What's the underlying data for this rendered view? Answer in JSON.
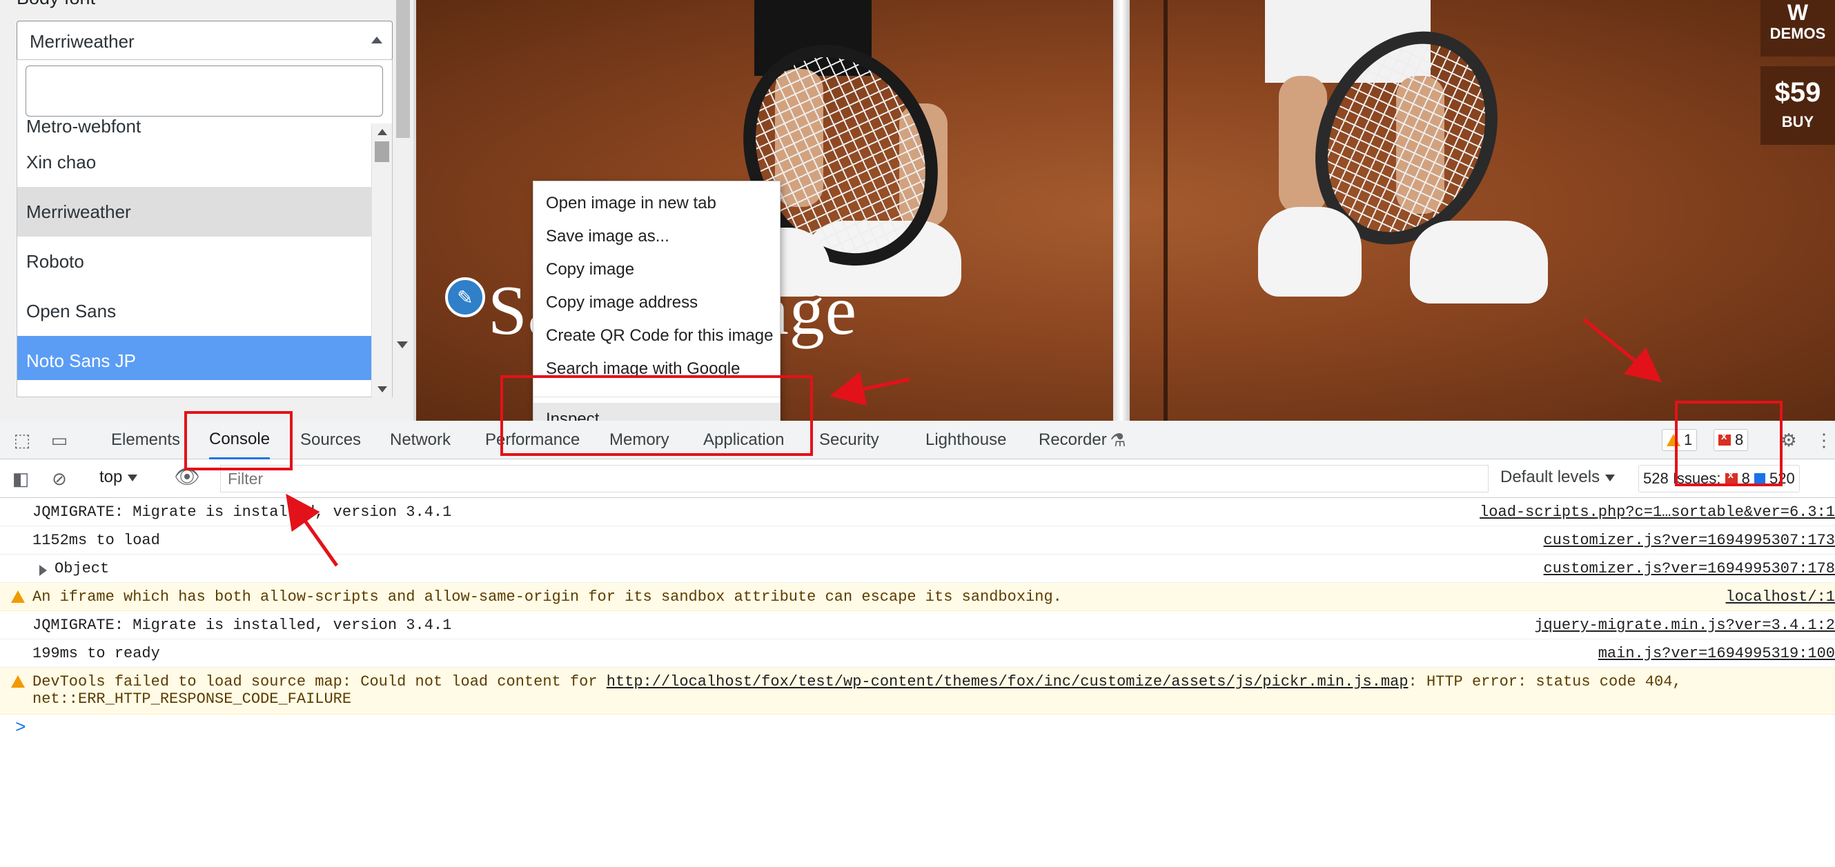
{
  "customizer": {
    "section_label": "Body font",
    "select_value": "Merriweather",
    "search_placeholder": "",
    "font_options": [
      {
        "label": "Metro-webfont",
        "state": "normal"
      },
      {
        "label": "Xin chao",
        "state": "normal"
      },
      {
        "label": "Merriweather",
        "state": "hover"
      },
      {
        "label": "Roboto",
        "state": "normal"
      },
      {
        "label": "Open Sans",
        "state": "normal"
      },
      {
        "label": "Noto Sans JP",
        "state": "selected"
      }
    ]
  },
  "preview": {
    "hero_title": "Sample page",
    "demos_label": "DEMOS",
    "wp_logo": "W",
    "price": "$59",
    "buy_label": "BUY"
  },
  "context_menu": {
    "items": [
      "Open image in new tab",
      "Save image as...",
      "Copy image",
      "Copy image address",
      "Create QR Code for this image",
      "Search image with Google"
    ],
    "inspect": "Inspect"
  },
  "devtools": {
    "tabs": [
      "Elements",
      "Console",
      "Sources",
      "Network",
      "Performance",
      "Memory",
      "Application",
      "Security",
      "Lighthouse",
      "Recorder"
    ],
    "active_tab": "Console",
    "warning_count": "1",
    "error_count": "8",
    "context": "top",
    "filter_placeholder": "Filter",
    "default_levels": "Default levels",
    "issues_prefix": "528 Issues:",
    "issues_errors": "8",
    "issues_info": "520"
  },
  "console": {
    "messages": [
      {
        "type": "log",
        "text": "JQMIGRATE: Migrate is installed, version 3.4.1",
        "source": "load-scripts.php?c=1…sortable&ver=6.3:1"
      },
      {
        "type": "log",
        "text": "1152ms to load",
        "source": "customizer.js?ver=1694995307:173"
      },
      {
        "type": "object",
        "text": "Object",
        "source": "customizer.js?ver=1694995307:178"
      },
      {
        "type": "warn",
        "text": "An iframe which has both allow-scripts and allow-same-origin for its sandbox attribute can escape its sandboxing.",
        "source": "localhost/:1"
      },
      {
        "type": "log",
        "text": "JQMIGRATE: Migrate is installed, version 3.4.1",
        "source": "jquery-migrate.min.js?ver=3.4.1:2"
      },
      {
        "type": "log",
        "text": "199ms to ready",
        "source": "main.js?ver=1694995319:100"
      }
    ],
    "sourcemap_warning": {
      "prefix": "DevTools failed to load source map: Could not load content for ",
      "url": "http://localhost/fox/test/wp-content/themes/fox/inc/customize/assets/js/pickr.min.js.map",
      "suffix": ": HTTP error: status code 404,",
      "line2": "net::ERR_HTTP_RESPONSE_CODE_FAILURE"
    },
    "prompt": ">"
  },
  "colors": {
    "annotation_red": "#e3121a",
    "selected_option": "#5b9df5",
    "active_tab_underline": "#1a73e8"
  }
}
